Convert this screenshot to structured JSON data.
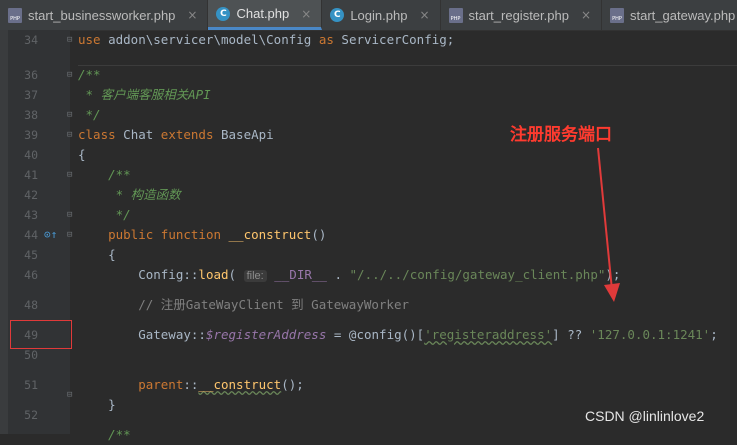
{
  "tabs": [
    {
      "label": "start_businessworker.php",
      "icon": "php-file-icon",
      "active": false
    },
    {
      "label": "Chat.php",
      "icon": "class-icon",
      "active": true
    },
    {
      "label": "Login.php",
      "icon": "class-icon",
      "active": false
    },
    {
      "label": "start_register.php",
      "icon": "php-file-icon",
      "active": false
    },
    {
      "label": "start_gateway.php",
      "icon": "php-file-icon",
      "active": false
    }
  ],
  "file_icon_text": "PHP",
  "class_icon_text": "C",
  "close_glyph": "×",
  "line_numbers": [
    "34",
    "36",
    "37",
    "38",
    "39",
    "40",
    "41",
    "42",
    "43",
    "44",
    "45",
    "46",
    "48",
    "49",
    "50",
    "51",
    "52"
  ],
  "code": {
    "l34_kw": "use",
    "l34_rest": " addon\\servicer\\model\\Config ",
    "l34_as": "as",
    "l34_alias": " ServicerConfig;",
    "l36": "/**",
    "l37": " * 客户端客服相关API",
    "l38": " */",
    "l39_class": "class",
    "l39_name": " Chat ",
    "l39_extends": "extends",
    "l39_base": " BaseApi",
    "l40": "{",
    "l41": "    /**",
    "l42": "     * 构造函数",
    "l43": "     */",
    "l44_public": "    public",
    "l44_function": " function ",
    "l44_name": "__construct",
    "l44_paren": "()",
    "l45": "    {",
    "l46_pre": "        Config::",
    "l46_fn": "load",
    "l46_open": "( ",
    "l46_hint": "file:",
    "l46_dir": " __DIR__",
    "l46_dot": " . ",
    "l46_str": "\"/../../config/gateway_client.php\"",
    "l46_end": ");",
    "l48": "        // 注册GateWayClient 到 GatewayWorker",
    "l49_pre": "        Gateway::",
    "l49_var": "$registerAddress",
    "l49_mid": " = @config()[",
    "l49_key": "'registeraddress'",
    "l49_mid2": "] ?? ",
    "l49_val": "'127.0.0.1:1241'",
    "l49_end": ";",
    "l51_parent": "        parent",
    "l51_colons": "::",
    "l51_fn": "__construct",
    "l51_end": "();",
    "l52": "    }",
    "l53": "    /**"
  },
  "annotation": "注册服务端口",
  "watermark": "CSDN @linlinlove2",
  "colors": {
    "annotation": "#ff3b2f",
    "keyword": "#cc7832",
    "string": "#6a8759",
    "comment": "#629755"
  }
}
